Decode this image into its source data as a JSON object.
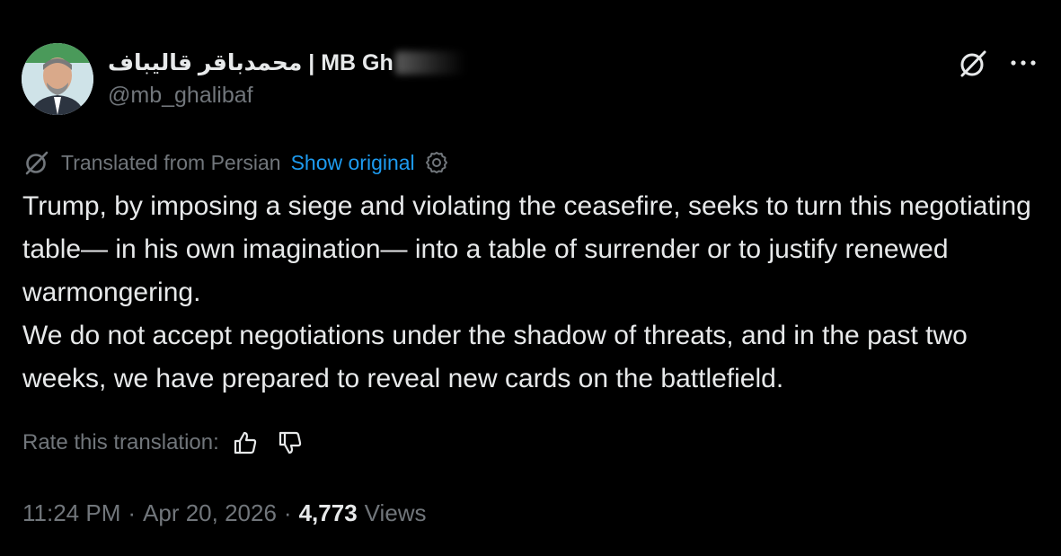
{
  "author": {
    "display_name": "محمدباقر قالیباف | MB Gh",
    "handle": "@mb_ghalibaf",
    "avatar_icon": "avatar-photo"
  },
  "header_actions": {
    "grok_icon": "grok-icon",
    "more_icon": "more-horizontal-icon"
  },
  "translation": {
    "label": "Translated from Persian",
    "show_original": "Show original",
    "settings_icon": "settings-icon",
    "icon": "translate-slash-icon"
  },
  "tweet": {
    "paragraphs": [
      "Trump, by imposing a siege and violating the ceasefire, seeks to turn this negotiating table— in his own imagination— into a table of surrender or to justify renewed warmongering.",
      "We do not accept negotiations under the shadow of threats, and in the past two weeks, we have prepared to reveal new cards on the battlefield."
    ]
  },
  "rating": {
    "label": "Rate this translation:",
    "up_icon": "thumbs-up-icon",
    "down_icon": "thumbs-down-icon"
  },
  "meta": {
    "time": "11:24 PM",
    "date": "Apr 20, 2026",
    "separator": "·",
    "views_count": "4,773",
    "views_label": "Views"
  },
  "colors": {
    "background": "#000000",
    "text": "#e7e9ea",
    "muted": "#71767b",
    "link": "#1d9bf0"
  }
}
